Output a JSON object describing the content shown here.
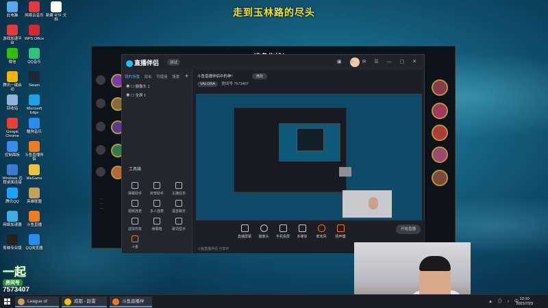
{
  "desktop": {
    "banner_text": "走到玉林路的尽头",
    "icons": [
      {
        "label": "此电脑",
        "color": "#5aa9e6"
      },
      {
        "label": "网易云音乐",
        "color": "#e33b3b"
      },
      {
        "label": "新建 RTF 文档",
        "color": "#ffffff"
      },
      {
        "label": "游戏加速平台",
        "color": "#e23b3b"
      },
      {
        "label": "WPS Office",
        "color": "#d6282d"
      },
      {
        "label": "微信",
        "color": "#2dc100"
      },
      {
        "label": "QQ音乐",
        "color": "#31c27c"
      },
      {
        "label": "腾讯一键启动",
        "color": "#f4b400"
      },
      {
        "label": "Steam",
        "color": "#1b2838"
      },
      {
        "label": "回收站",
        "color": "#8fb4d8"
      },
      {
        "label": "Microsoft Edge",
        "color": "#1fa0e6"
      },
      {
        "label": "Google Chrome",
        "color": "#e94235"
      },
      {
        "label": "酷狗音乐",
        "color": "#2a8cf0"
      },
      {
        "label": "控制面板",
        "color": "#3a8ee6"
      },
      {
        "label": "斗鱼直播伴侣",
        "color": "#f07c1e"
      },
      {
        "label": "Windows 远程桌面连接",
        "color": "#3a7bd5"
      },
      {
        "label": "WeGame",
        "color": "#f0c23a"
      },
      {
        "label": "腾讯QQ",
        "color": "#1aa3ff"
      },
      {
        "label": "英雄联盟",
        "color": "#c4a25a"
      },
      {
        "label": "网络加速器",
        "color": "#3ab0e0"
      },
      {
        "label": "斗鱼直播",
        "color": "#f07c1e"
      },
      {
        "label": "剪映专业版",
        "color": "#222222"
      },
      {
        "label": "QQ浏览器",
        "color": "#2a8cf0"
      }
    ]
  },
  "game_window": {
    "title": "准备作战！"
  },
  "streaming_app": {
    "logo_text": "直播伴侣",
    "version": "测试",
    "tabs": [
      "我的场景",
      "双击",
      "可使用",
      "场景"
    ],
    "layers": [
      {
        "label": "摄像头 1"
      },
      {
        "label": "全屏 1"
      }
    ],
    "tools_label": "工具箱",
    "tools": [
      "弹幕助手",
      "房管助手",
      "主播任务",
      "视频连麦",
      "多人连麦",
      "语音聊天",
      "虚拟形象",
      "弹幕箱",
      "歌词显示",
      "斗鱼"
    ],
    "stream_title": "斗鱼直播伴侣中的神！",
    "edit_label": "修改",
    "category": "VALORA",
    "room_label": "房间号",
    "room_number": "7573407",
    "bottom_tools": [
      "直播屏幕",
      "摄像头",
      "手机投屏",
      "多媒体",
      "麦克风",
      "扬声器"
    ],
    "start_label": "开始直播",
    "status_text": "斗鱼直播伴侣 分享中"
  },
  "room_overlay": {
    "big_text": "一起",
    "label": "房间号",
    "number": "7573407"
  },
  "taskbar": {
    "items": [
      {
        "label": "League of Legends",
        "color": "#c4a25a"
      },
      {
        "label": "成都 - 赵雷",
        "color": "#f4c40a"
      },
      {
        "label": "斗鱼直播伴侣",
        "color": "#f07c1e"
      }
    ],
    "time": "12:10",
    "date": "2021/7/23"
  }
}
